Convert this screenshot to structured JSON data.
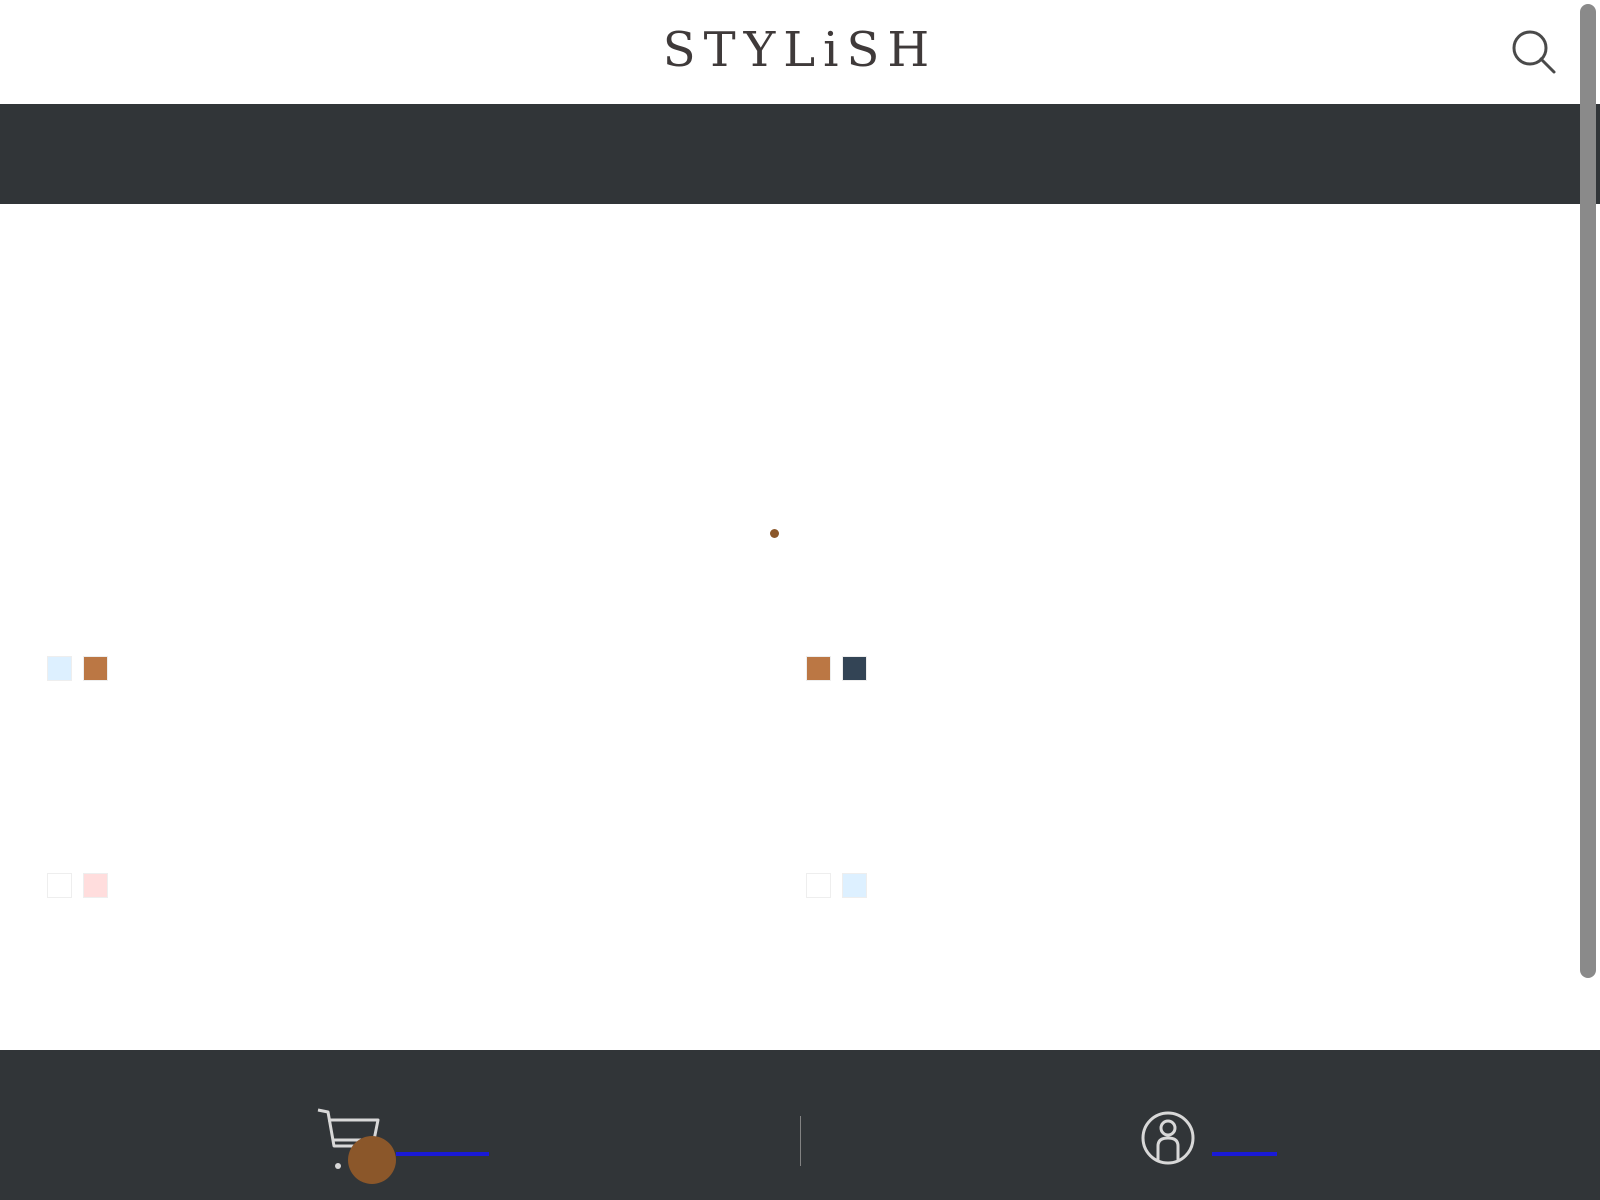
{
  "header": {
    "logo_text": "STYLiSH",
    "search_icon": "search-icon"
  },
  "category_bar": {
    "items": []
  },
  "loading": {
    "icon": "loading-dot",
    "color": "#8b572a"
  },
  "products": [
    {
      "colors": [
        "#DDF0FF",
        "#BB7744"
      ]
    },
    {
      "colors": [
        "#BB7744",
        "#334455"
      ]
    },
    {
      "colors": [
        "#FFFFFF",
        "#FFDDDD"
      ]
    },
    {
      "colors": [
        "#FFFFFF",
        "#DDF0FF"
      ]
    }
  ],
  "bottom_nav": {
    "cart_icon": "cart-icon",
    "cart_badge_color": "#8b572a",
    "cart_badge_count": "",
    "member_icon": "member-icon"
  },
  "colors": {
    "header_bg": "#ffffff",
    "dark_bar": "#313538",
    "logo": "#3f3a3a",
    "accent": "#8b572a",
    "link_underline": "#1a1ad6"
  }
}
